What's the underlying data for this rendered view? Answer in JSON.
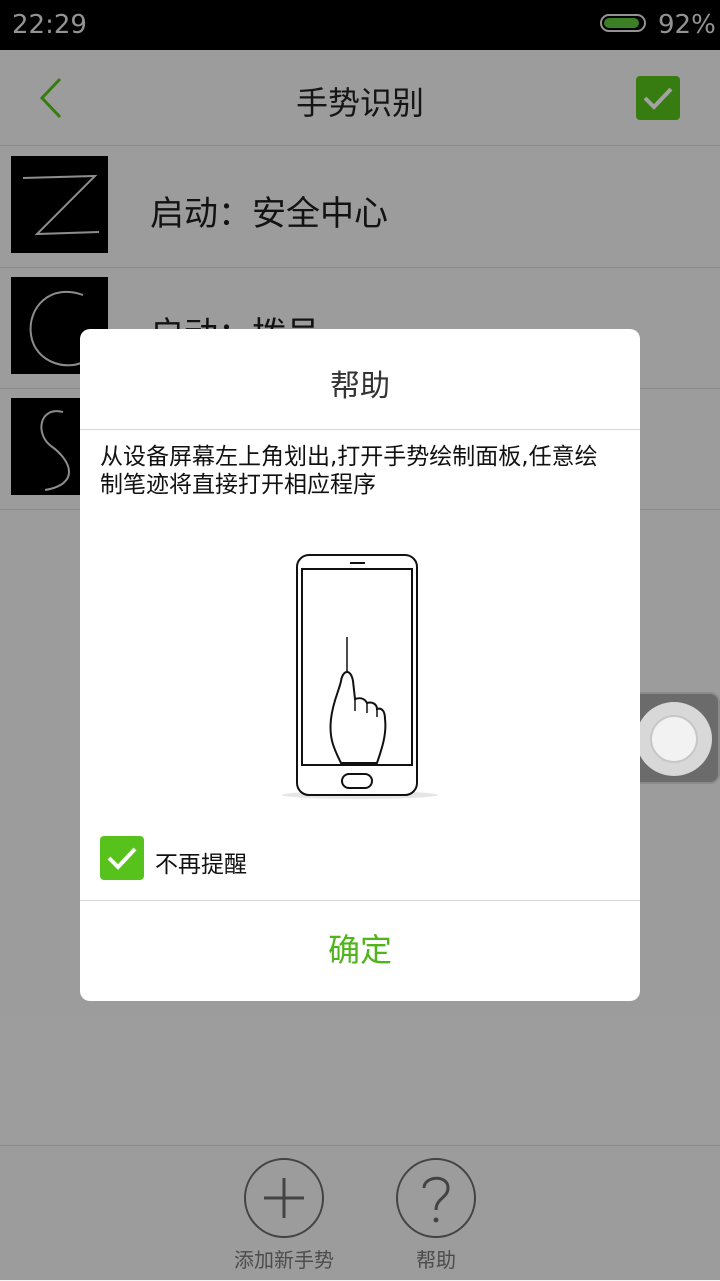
{
  "status_bar": {
    "time": "22:29",
    "battery_percent_text": "92%",
    "battery_level": 0.92
  },
  "header": {
    "title": "手势识别"
  },
  "gesture_list": [
    {
      "label": "启动：安全中心",
      "shape": "Z"
    },
    {
      "label": "启动：拨号",
      "shape": "C"
    },
    {
      "label": "",
      "shape": "S"
    }
  ],
  "bottom_toolbar": {
    "add_label": "添加新手势",
    "help_label": "帮助"
  },
  "dialog": {
    "title": "帮助",
    "message": "从设备屏幕左上角划出,打开手势绘制面板,任意绘制笔迹将直接打开相应程序",
    "checkbox_label": "不再提醒",
    "checkbox_checked": true,
    "ok_label": "确定"
  },
  "colors": {
    "accent": "#57c21b",
    "ok_text": "#4fb51a"
  },
  "icons": {
    "back": "chevron-left-icon",
    "confirm": "checkmark-icon",
    "add": "plus-icon",
    "help": "question-mark-icon",
    "floating": "floating-ball-icon"
  }
}
